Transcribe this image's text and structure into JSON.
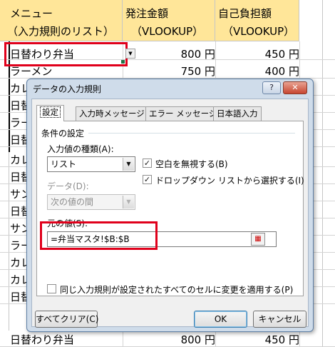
{
  "sheet": {
    "headers": {
      "col_a_line1": "メニュー",
      "col_a_line2": "（入力規則のリスト）",
      "col_b_line1": "発注金額",
      "col_b_line2": "（VLOOKUP）",
      "col_c_line1": "自己負担額",
      "col_c_line2": "（VLOOKUP）"
    },
    "rows": [
      {
        "menu": "日替わり弁当",
        "order": "800 円",
        "self": "450 円"
      },
      {
        "menu": "ラーメン",
        "order": "750 円",
        "self": "400 円"
      },
      {
        "menu": "カレ",
        "order": "",
        "self": ""
      },
      {
        "menu": "日替",
        "order": "",
        "self": ""
      },
      {
        "menu": "ラー",
        "order": "",
        "self": ""
      },
      {
        "menu": "日替",
        "order": "",
        "self": ""
      },
      {
        "menu": "カレ",
        "order": "",
        "self": ""
      },
      {
        "menu": "日替",
        "order": "",
        "self": ""
      },
      {
        "menu": "サン",
        "order": "",
        "self": ""
      },
      {
        "menu": "日替",
        "order": "",
        "self": ""
      },
      {
        "menu": "サン",
        "order": "",
        "self": ""
      },
      {
        "menu": "ラー",
        "order": "",
        "self": ""
      },
      {
        "menu": "カレ",
        "order": "",
        "self": ""
      },
      {
        "menu": "カレ",
        "order": "",
        "self": ""
      },
      {
        "menu": "日替",
        "order": "",
        "self": ""
      },
      {
        "menu": "日替わり弁当",
        "order": "800 円",
        "self": "450 円"
      }
    ]
  },
  "dialog": {
    "title": "データの入力規則",
    "help_label": "?",
    "close_label": "✕",
    "tabs": [
      {
        "label": "設定",
        "active": true
      },
      {
        "label": "入力時メッセージ",
        "active": false
      },
      {
        "label": "エラー メッセージ",
        "active": false
      },
      {
        "label": "日本語入力",
        "active": false
      }
    ],
    "settings": {
      "group_label": "条件の設定",
      "allow_label": "入力値の種類(A):",
      "allow_value": "リスト",
      "ignore_blank_label": "空白を無視する(B)",
      "ignore_blank_checked": true,
      "dropdown_label": "ドロップダウン リストから選択する(I)",
      "dropdown_checked": true,
      "data_label": "データ(D):",
      "data_value": "次の値の間",
      "source_label": "元の値(S):",
      "source_value": "=弁当マスタ!$B:$B",
      "apply_all_label": "同じ入力規則が設定されたすべてのセルに変更を適用する(P)",
      "apply_all_checked": false
    },
    "buttons": {
      "clear_all": "すべてクリア(C)",
      "ok": "OK",
      "cancel": "キャンセル"
    }
  }
}
